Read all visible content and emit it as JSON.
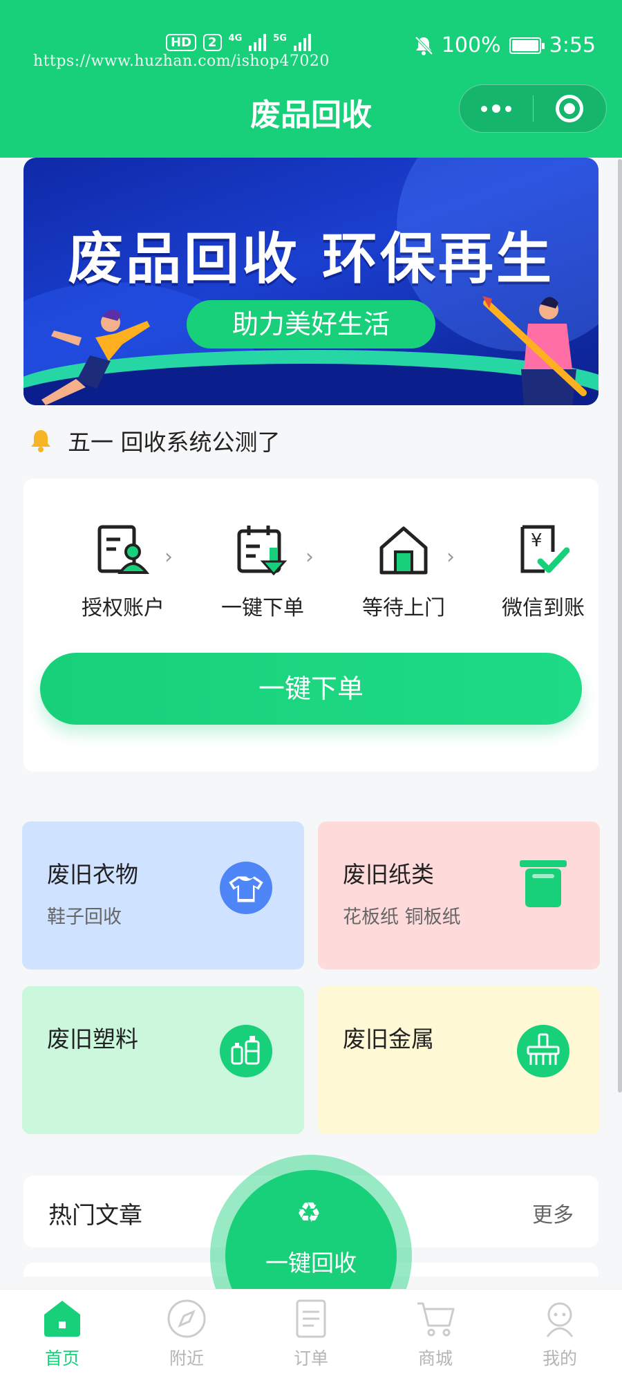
{
  "statusbar": {
    "hd": "HD",
    "sim": "2",
    "net1": "4G",
    "net2": "5G",
    "battery": "100%",
    "battery_level": 1.0,
    "time": "3:55"
  },
  "watermark": "https://www.huzhan.com/ishop47020",
  "header": {
    "title": "废品回收",
    "accent": "#19d07a"
  },
  "banner": {
    "headline": "废品回收 环保再生",
    "pill": "助力美好生活"
  },
  "notice": {
    "text": "五一 回收系统公测了"
  },
  "steps": [
    {
      "label": "授权账户",
      "icon": "account-icon"
    },
    {
      "label": "一键下单",
      "icon": "calendar-download-icon"
    },
    {
      "label": "等待上门",
      "icon": "house-icon"
    },
    {
      "label": "微信到账",
      "icon": "yuan-check-icon"
    }
  ],
  "order_button": "一键下单",
  "categories": [
    {
      "title": "废旧衣物",
      "sub": "鞋子回收",
      "color": "#cfe2ff",
      "icon": "tshirt-icon"
    },
    {
      "title": "废旧纸类",
      "sub": "花板纸 铜板纸",
      "color": "#ffdada",
      "icon": "bin-icon"
    },
    {
      "title": "废旧塑料",
      "sub": "",
      "color": "#cbf8dc",
      "icon": "bottles-icon"
    },
    {
      "title": "废旧金属",
      "sub": "",
      "color": "#fff9d6",
      "icon": "metal-icon"
    }
  ],
  "articles": {
    "title": "热门文章",
    "more": "更多"
  },
  "fab": {
    "label": "一键回收",
    "icon": "recycle-icon"
  },
  "tabs": [
    {
      "label": "首页",
      "icon": "home-icon",
      "active": true
    },
    {
      "label": "附近",
      "icon": "compass-icon",
      "active": false
    },
    {
      "label": "订单",
      "icon": "document-icon",
      "active": false
    },
    {
      "label": "商城",
      "icon": "cart-icon",
      "active": false
    },
    {
      "label": "我的",
      "icon": "user-icon",
      "active": false
    }
  ]
}
